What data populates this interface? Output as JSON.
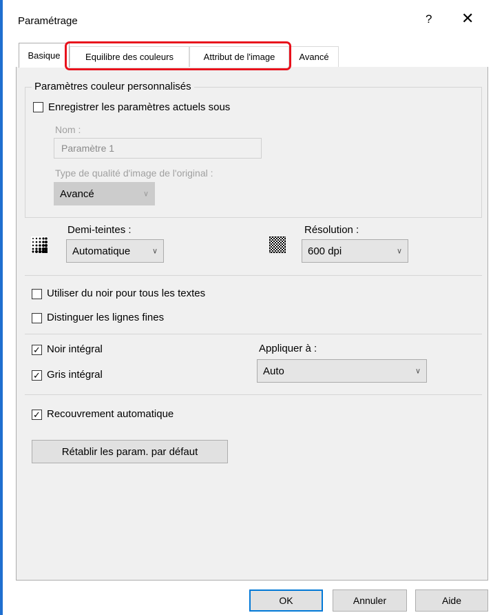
{
  "window": {
    "title": "Paramétrage",
    "help_icon": "?",
    "close_icon": "✕"
  },
  "tabs": [
    {
      "label": "Basique",
      "active": true
    },
    {
      "label": "Equilibre des couleurs",
      "active": false
    },
    {
      "label": "Attribut de l'image",
      "active": false
    },
    {
      "label": "Avancé",
      "active": false
    }
  ],
  "custom_settings": {
    "group_label": "Paramètres couleur personnalisés",
    "save_checkbox_label": "Enregistrer les paramètres actuels sous",
    "save_checked": false,
    "name_label": "Nom :",
    "name_value": "Paramètre 1",
    "quality_label": "Type de qualité d'image de l'original :",
    "quality_value": "Avancé"
  },
  "halftone": {
    "label": "Demi-teintes :",
    "value": "Automatique",
    "icon": "halftone-icon"
  },
  "resolution": {
    "label": "Résolution :",
    "value": "600 dpi",
    "icon": "resolution-icon"
  },
  "options": {
    "black_text_label": "Utiliser du noir pour tous les textes",
    "black_text_checked": false,
    "fine_lines_label": "Distinguer les lignes fines",
    "fine_lines_checked": false,
    "pure_black_label": "Noir intégral",
    "pure_black_checked": true,
    "pure_gray_label": "Gris intégral",
    "pure_gray_checked": true,
    "apply_to_label": "Appliquer à :",
    "apply_to_value": "Auto",
    "auto_trapping_label": "Recouvrement automatique",
    "auto_trapping_checked": true
  },
  "buttons": {
    "restore_defaults": "Rétablir les param. par défaut",
    "ok": "OK",
    "cancel": "Annuler",
    "help": "Aide"
  },
  "colors": {
    "highlight": "#e8111c",
    "window_border": "#1f6fd0",
    "panel_bg": "#f0f0f0"
  }
}
